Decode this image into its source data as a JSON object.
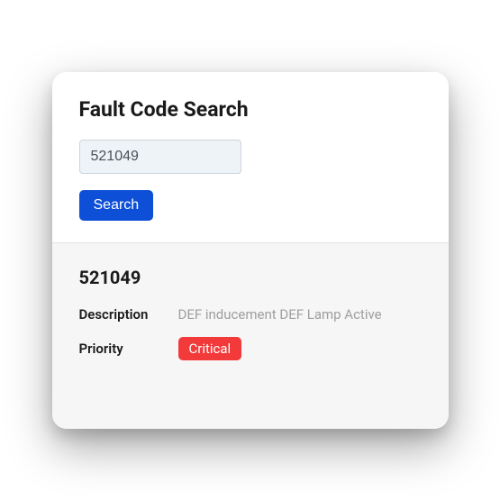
{
  "header": {
    "title": "Fault Code Search"
  },
  "search": {
    "value": "521049",
    "button_label": "Search"
  },
  "result": {
    "code": "521049",
    "description_label": "Description",
    "description_value": "DEF inducement DEF Lamp Active",
    "priority_label": "Priority",
    "priority_value": "Critical"
  },
  "colors": {
    "primary": "#0d4fd6",
    "danger": "#f23a3a"
  }
}
